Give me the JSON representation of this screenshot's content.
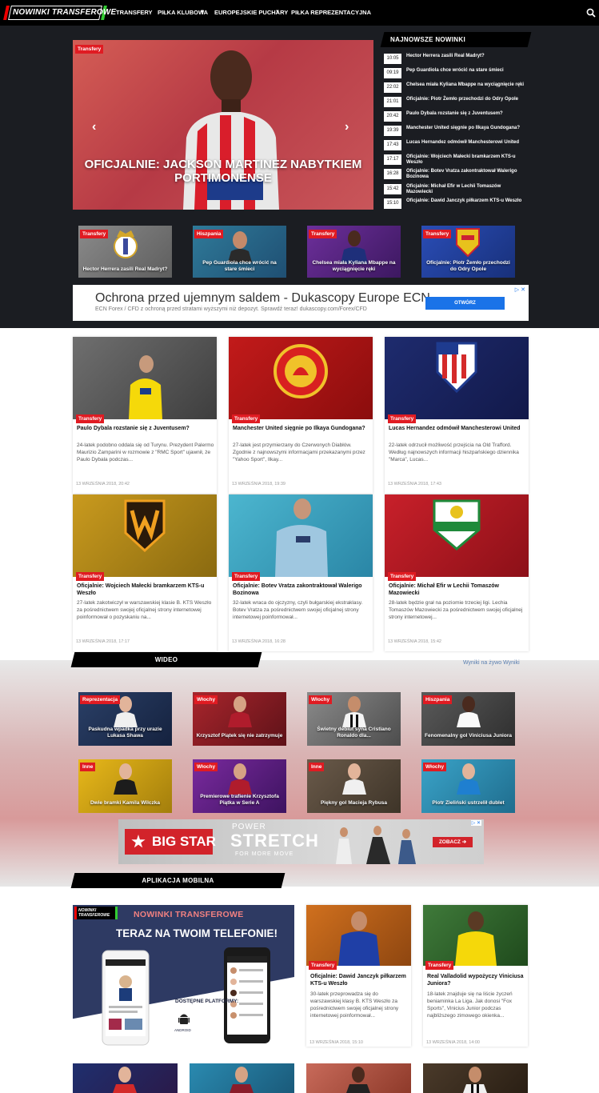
{
  "nav": {
    "logo": "NOWINKI TRANSFEROWE",
    "items": [
      "TRANSFERY",
      "PIŁKA KLUBOWA",
      "EUROPEJSKIE PUCHARY",
      "PIŁKA REPREZENTACYJNA"
    ]
  },
  "slider": {
    "tag": "Transfery",
    "title": "OFICJALNIE: JACKSON MARTINEZ NABYTKIEM PORTIMONENSE"
  },
  "latest": {
    "heading": "NAJNOWSZE NOWINKI",
    "items": [
      {
        "time": "10:05",
        "title": "Hector Herrera zasili Real Madryt?"
      },
      {
        "time": "09:19",
        "title": "Pep Guardiola chce wrócić na stare śmieci"
      },
      {
        "time": "22:02",
        "title": "Chelsea miała Kyliana Mbappe na wyciągnięcie ręki"
      },
      {
        "time": "21:01",
        "title": "Oficjalnie: Piotr Żemło przechodzi do Odry Opole"
      },
      {
        "time": "20:42",
        "title": "Paulo Dybala rozstanie się z Juventusem?"
      },
      {
        "time": "19:39",
        "title": "Manchester United sięgnie po Ilkaya Gundogana?"
      },
      {
        "time": "17:43",
        "title": "Lucas Hernandez odmówił Manchesterowi United"
      },
      {
        "time": "17:17",
        "title": "Oficjalnie: Wojciech Małecki bramkarzem KTS-u Weszło"
      },
      {
        "time": "16:28",
        "title": "Oficjalnie: Botev Vratza zakontraktował Walerigo Bozinowa"
      },
      {
        "time": "15:42",
        "title": "Oficjalnie: Michał Efir w Lechii Tomaszów Mazowiecki"
      },
      {
        "time": "15:10",
        "title": "Oficjalnie: Dawid Janczyk piłkarzem KTS-u Weszło"
      }
    ]
  },
  "thumbs": [
    {
      "tag": "Transfery",
      "caption": "Hector Herrera zasili Real Madryt?"
    },
    {
      "tag": "Hiszpania",
      "caption": "Pep Guardiola chce wrócić na stare śmieci"
    },
    {
      "tag": "Transfery",
      "caption": "Chelsea miała Kyliana Mbappe na wyciągnięcie ręki"
    },
    {
      "tag": "Transfery",
      "caption": "Oficjalnie: Piotr Żemło przechodzi do Odry Opole"
    }
  ],
  "ad1": {
    "title": "Ochrona przed ujemnym saldem - Dukascopy Europe ECN",
    "subtitle": "ECN Forex / CFD z ochroną przed stratami wyższymi niż depozyt. Sprawdź teraz! dukascopy.com/Forex/CFD",
    "button": "OTWÓRZ",
    "ad_mark": "▷ ✕"
  },
  "cards": [
    {
      "tag": "Transfery",
      "title": "Paulo Dybala rozstanie się z Juventusem?",
      "desc": "24-latek podobno oddala się od Turynu. Prezydent Palermo Maurizio Zamparini w rozmowie z \"RMC Sport\" ujawnił, że Paulo Dybala podczas...",
      "date": "13 WRZEŚNIA 2018, 20:42"
    },
    {
      "tag": "Transfery",
      "title": "Manchester United sięgnie po Ilkaya Gundogana?",
      "desc": "27-latek jest przymierzany do Czerwonych Diabłów. Zgodnie z najnowszymi informacjami przekazanymi przez \"Yahoo Sport\", Ilkay...",
      "date": "13 WRZEŚNIA 2018, 19:39"
    },
    {
      "tag": "Transfery",
      "title": "Lucas Hernandez odmówił Manchesterowi United",
      "desc": "22-latek odrzucił możliwość przejścia na Old Trafford. Według najnowszych informacji hiszpańskiego dziennika \"Marca\", Lucas...",
      "date": "13 WRZEŚNIA 2018, 17:43"
    },
    {
      "tag": "Transfery",
      "title": "Oficjalnie: Wojciech Małecki bramkarzem KTS-u Weszło",
      "desc": "27-latek zakotwiczył w warszawskiej klasie B. KTS Weszło za pośrednictwem swojej oficjalnej strony internetowej poinformował o pozyskaniu na...",
      "date": "13 WRZEŚNIA 2018, 17:17"
    },
    {
      "tag": "Transfery",
      "title": "Oficjalnie: Botev Vratza zakontraktował Walerigo Bozinowa",
      "desc": "32-latek wraca do ojczyzny, czyli bułgarskiej ekstraklasy. Botev Vratza za pośrednictwem swojej oficjalnej strony internetowej poinformował...",
      "date": "13 WRZEŚNIA 2018, 16:28"
    },
    {
      "tag": "Transfery",
      "title": "Oficjalnie: Michał Efir w Lechii Tomaszów Mazowiecki",
      "desc": "28-latek będzie grał na poziomie trzeciej ligi. Lechia Tomaszów Mazowiecki za pośrednictwem swojej oficjalnej strony internetowej...",
      "date": "13 WRZEŚNIA 2018, 15:42"
    }
  ],
  "video": {
    "heading": "WIDEO",
    "live_link": "Wyniki na żywo Wyniki",
    "items": [
      {
        "tag": "Reprezentacja",
        "caption": "Paskudna wpadka przy urazie Lukasa Shawa"
      },
      {
        "tag": "Włochy",
        "caption": "Krzysztof Piątek się nie zatrzymuje"
      },
      {
        "tag": "Włochy",
        "caption": "Świetny debiut syna Cristiano Ronaldo dla..."
      },
      {
        "tag": "Hiszpania",
        "caption": "Fenomenalny gol Viniciusa Juniora"
      },
      {
        "tag": "Inne",
        "caption": "Dwie bramki Kamila Wilczka"
      },
      {
        "tag": "Włochy",
        "caption": "Premierowe trafienie Krzysztofa Piątka w Serie A"
      },
      {
        "tag": "Inne",
        "caption": "Piękny gol Macieja Rybusa"
      },
      {
        "tag": "Włochy",
        "caption": "Piotr Zieliński ustrzelił dublet"
      }
    ]
  },
  "ad2": {
    "brand": "BIG STAR",
    "line1": "POWER",
    "line2": "STRETCH",
    "line3": "FOR MORE MOVE",
    "button": "ZOBACZ ➔",
    "ad_mark": "▷ ✕"
  },
  "app": {
    "heading": "APLIKACJA MOBILNA",
    "logo": "NOWINKI TRANSFEROWE",
    "title": "NOWINKI TRANSFEROWE",
    "subtitle": "TERAZ NA TWOIM TELEFONIE!",
    "platforms": "DOSTĘPNE PLATFORMY:",
    "android": "ANDROID"
  },
  "app_cards": [
    {
      "tag": "Transfery",
      "title": "Oficjalnie: Dawid Janczyk piłkarzem KTS-u Weszło",
      "desc": "30-latek przeprowadza się do warszawskiej klasy B. KTS Weszło za pośrednictwem swojej oficjalnej strony internetowej poinformował...",
      "date": "13 WRZEŚNIA 2018, 15:10"
    },
    {
      "tag": "Transfery",
      "title": "Real Valladolid wypożyczy Viniciusa Juniora?",
      "desc": "18-latek znajduje się na liście życzeń beniaminka La Liga. Jak donosi \"Fox Sports\", Vinicius Junior podczas najbliższego zimowego okienka...",
      "date": "13 WRZEŚNIA 2018, 14:00"
    }
  ],
  "colors": {
    "accent": "#e01b22",
    "dark_band": "#1b1d22",
    "nav": "#000000",
    "link": "#5a7fb0"
  }
}
